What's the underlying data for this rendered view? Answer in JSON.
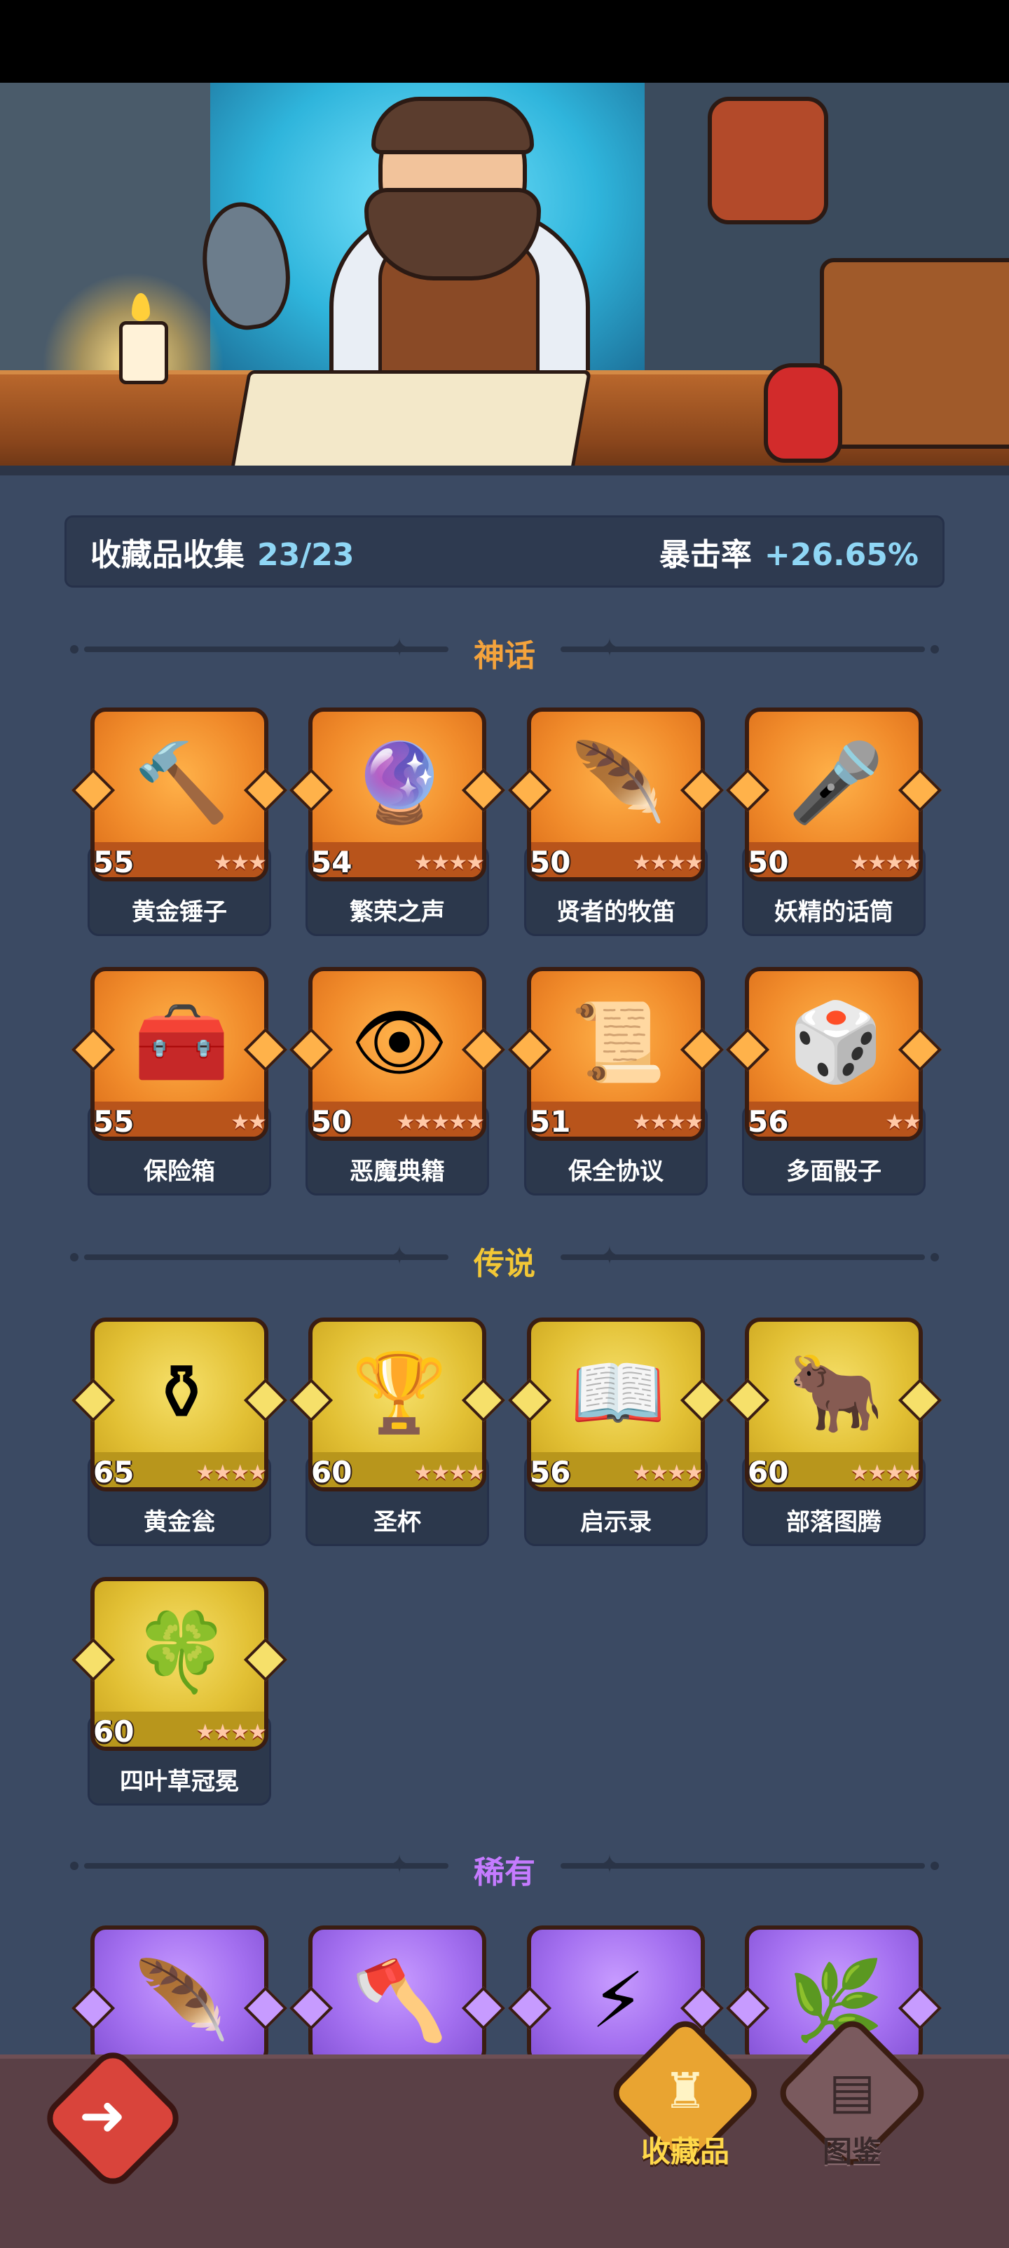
{
  "stats": {
    "collection_label": "收藏品收集",
    "collection_value": "23/23",
    "crit_label": "暴击率",
    "crit_value": "+26.65%"
  },
  "sections": {
    "mythic": "神话",
    "legendary": "传说",
    "rare": "稀有"
  },
  "mythic_items": [
    {
      "name": "黄金锤子",
      "level": "55",
      "stars": 3,
      "icon": "golden-hammer-icon"
    },
    {
      "name": "繁荣之声",
      "level": "54",
      "stars": 4,
      "icon": "horn-orb-icon"
    },
    {
      "name": "贤者的牧笛",
      "level": "50",
      "stars": 4,
      "icon": "flute-icon"
    },
    {
      "name": "妖精的话筒",
      "level": "50",
      "stars": 4,
      "icon": "fairy-microphone-icon"
    },
    {
      "name": "保险箱",
      "level": "55",
      "stars": 2,
      "icon": "treasure-chest-icon"
    },
    {
      "name": "恶魔典籍",
      "level": "50",
      "stars": 5,
      "icon": "demon-book-icon"
    },
    {
      "name": "保全协议",
      "level": "51",
      "stars": 4,
      "icon": "scroll-contract-icon"
    },
    {
      "name": "多面骰子",
      "level": "56",
      "stars": 2,
      "icon": "d20-dice-icon"
    }
  ],
  "legendary_items": [
    {
      "name": "黄金瓮",
      "level": "65",
      "stars": 4,
      "icon": "golden-urn-icon"
    },
    {
      "name": "圣杯",
      "level": "60",
      "stars": 4,
      "icon": "holy-grail-icon"
    },
    {
      "name": "启示录",
      "level": "56",
      "stars": 4,
      "icon": "open-book-icon"
    },
    {
      "name": "部落图腾",
      "level": "60",
      "stars": 4,
      "icon": "tribal-totem-icon"
    },
    {
      "name": "四叶草冠冕",
      "level": "60",
      "stars": 4,
      "icon": "clover-crown-icon"
    }
  ],
  "rare_items": [
    {
      "icon": "feather-icon"
    },
    {
      "icon": "axe-icon"
    },
    {
      "icon": "lightning-card-icon"
    },
    {
      "icon": "thorn-vine-icon"
    }
  ],
  "bottom_nav": {
    "back_icon": "back-arrow-icon",
    "tab_collection": "收藏品",
    "tab_codex": "图鉴"
  },
  "colors": {
    "mythic": "#f08a2a",
    "legendary": "#e2c034",
    "rare": "#a470f0",
    "background": "#3b4a63"
  }
}
